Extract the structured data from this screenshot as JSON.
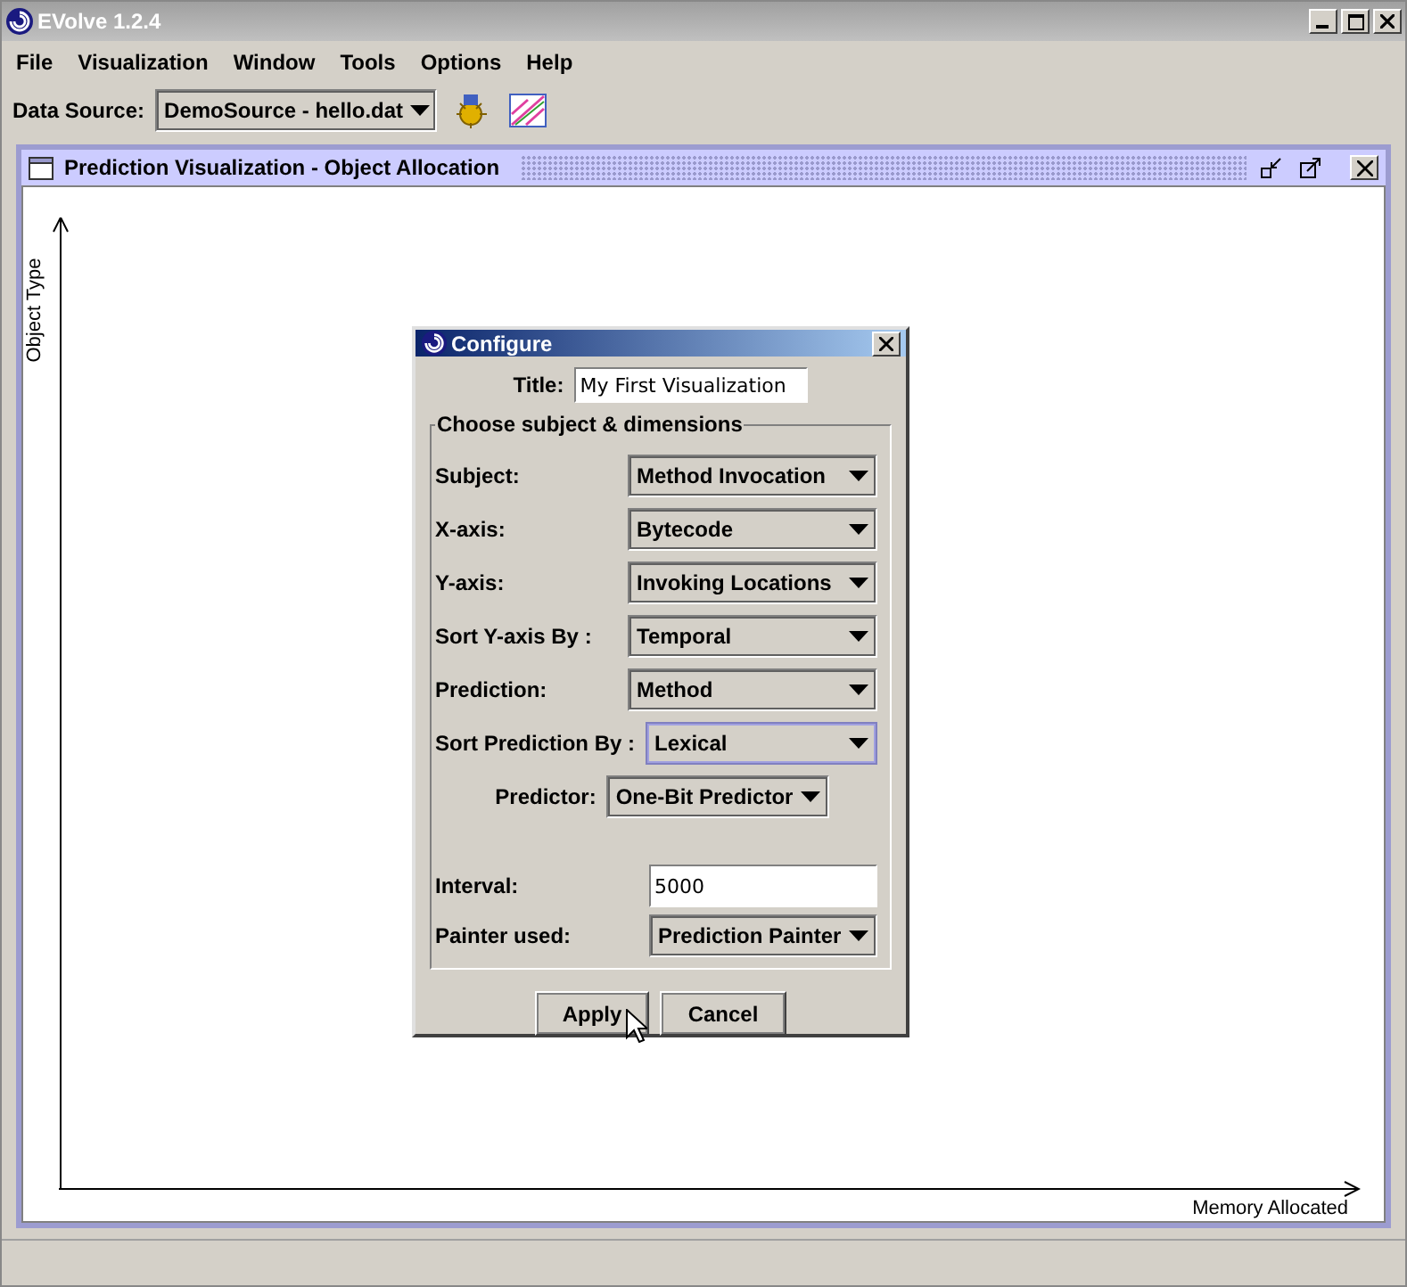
{
  "window": {
    "title": "EVolve 1.2.4"
  },
  "menu": [
    "File",
    "Visualization",
    "Window",
    "Tools",
    "Options",
    "Help"
  ],
  "toolbar": {
    "label": "Data Source:",
    "source": "DemoSource - hello.dat"
  },
  "frame": {
    "title": "Prediction Visualization - Object Allocation",
    "y_axis_label": "Object Type",
    "x_axis_label": "Memory Allocated"
  },
  "dialog": {
    "title": "Configure",
    "title_label": "Title:",
    "title_value": "My First Visualization",
    "group_title": "Choose subject & dimensions",
    "rows": [
      {
        "label": "Subject:",
        "value": "Method Invocation",
        "focused": false
      },
      {
        "label": "X-axis:",
        "value": "Bytecode",
        "focused": false
      },
      {
        "label": "Y-axis:",
        "value": "Invoking Locations",
        "focused": false
      },
      {
        "label": "Sort Y-axis By :",
        "value": "Temporal",
        "focused": false
      },
      {
        "label": "Prediction:",
        "value": "Method",
        "focused": false
      },
      {
        "label": "Sort Prediction By :",
        "value": "Lexical",
        "focused": true
      }
    ],
    "predictor": {
      "label": "Predictor:",
      "value": "One-Bit Predictor"
    },
    "interval": {
      "label": "Interval:",
      "value": "5000"
    },
    "painter": {
      "label": "Painter used:",
      "value": "Prediction Painter"
    },
    "buttons": [
      "Apply",
      "Cancel"
    ]
  }
}
